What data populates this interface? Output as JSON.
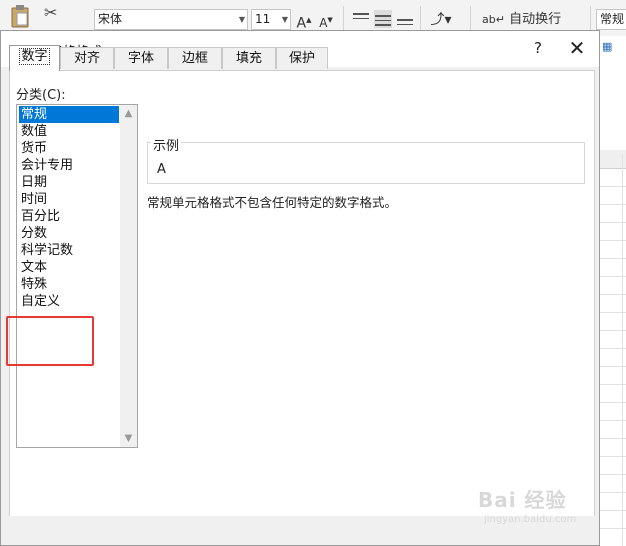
{
  "ribbon": {
    "font_name": "宋体",
    "font_size": "11",
    "grow_font": "A",
    "shrink_font": "A",
    "wrap_text": "自动换行",
    "number_format": "常规"
  },
  "dialog": {
    "title": "设置单元格格式",
    "help": "?",
    "close": "✕",
    "tabs": [
      "数字",
      "对齐",
      "字体",
      "边框",
      "填充",
      "保护"
    ],
    "active_tab": "数字",
    "category_label": "分类(C):",
    "categories": [
      "常规",
      "数值",
      "货币",
      "会计专用",
      "日期",
      "时间",
      "百分比",
      "分数",
      "科学记数",
      "文本",
      "特殊",
      "自定义"
    ],
    "selected_category": "常规",
    "sample_label": "示例",
    "sample_value": "A",
    "description": "常规单元格格式不包含任何特定的数字格式。"
  },
  "watermark": {
    "main": "Bai 经验",
    "sub": "jingyan.baidu.com"
  },
  "colors": {
    "selection": "#0078d7",
    "highlight_box": "#e53935"
  }
}
